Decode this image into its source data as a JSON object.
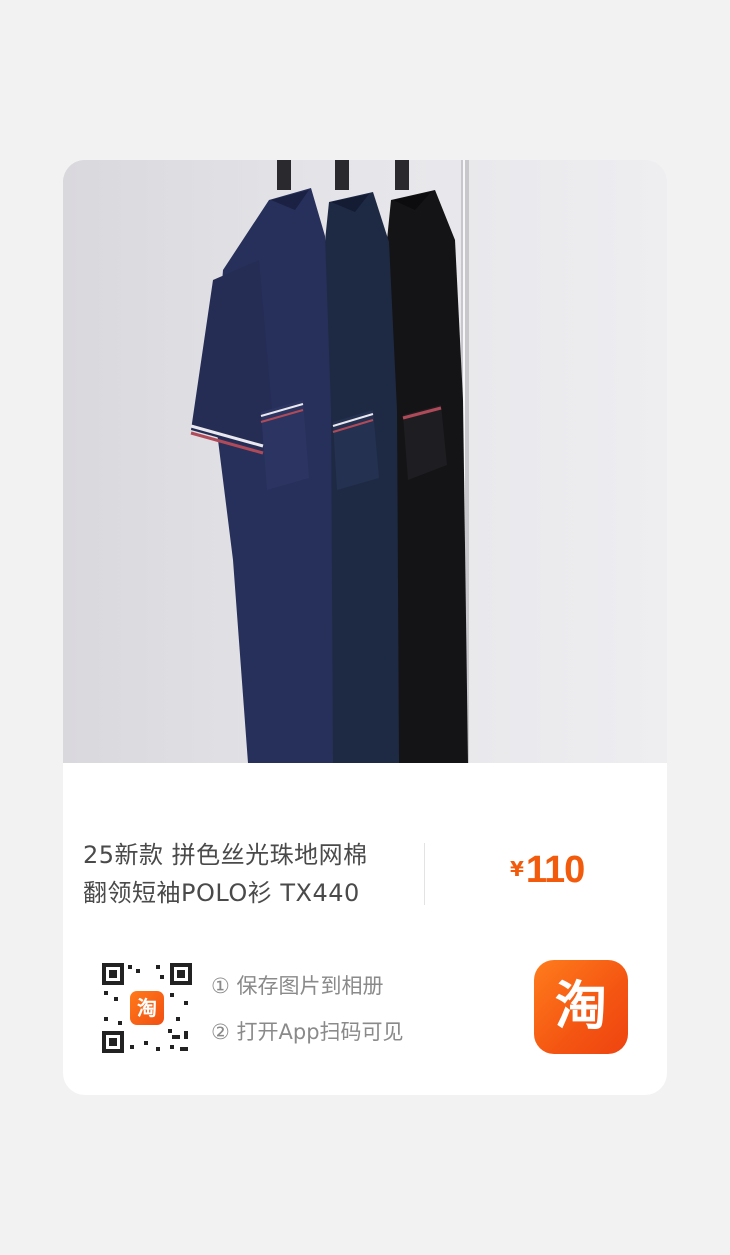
{
  "product": {
    "title_line1": "25新款 拼色丝光珠地网棉",
    "title_line2": "翻领短袖POLO衫 TX440",
    "price_symbol": "¥",
    "price_value": "110"
  },
  "share": {
    "step1_num": "①",
    "step1_text": "保存图片到相册",
    "step2_num": "②",
    "step2_text": "打开App扫码可见",
    "qr_logo_char": "淘",
    "app_icon_char": "淘"
  },
  "colors": {
    "accent": "#f25a0c",
    "background": "#f2f2f2",
    "card": "#ffffff"
  },
  "icons": {
    "qr": "qr-code-icon",
    "app": "taobao-app-icon"
  }
}
